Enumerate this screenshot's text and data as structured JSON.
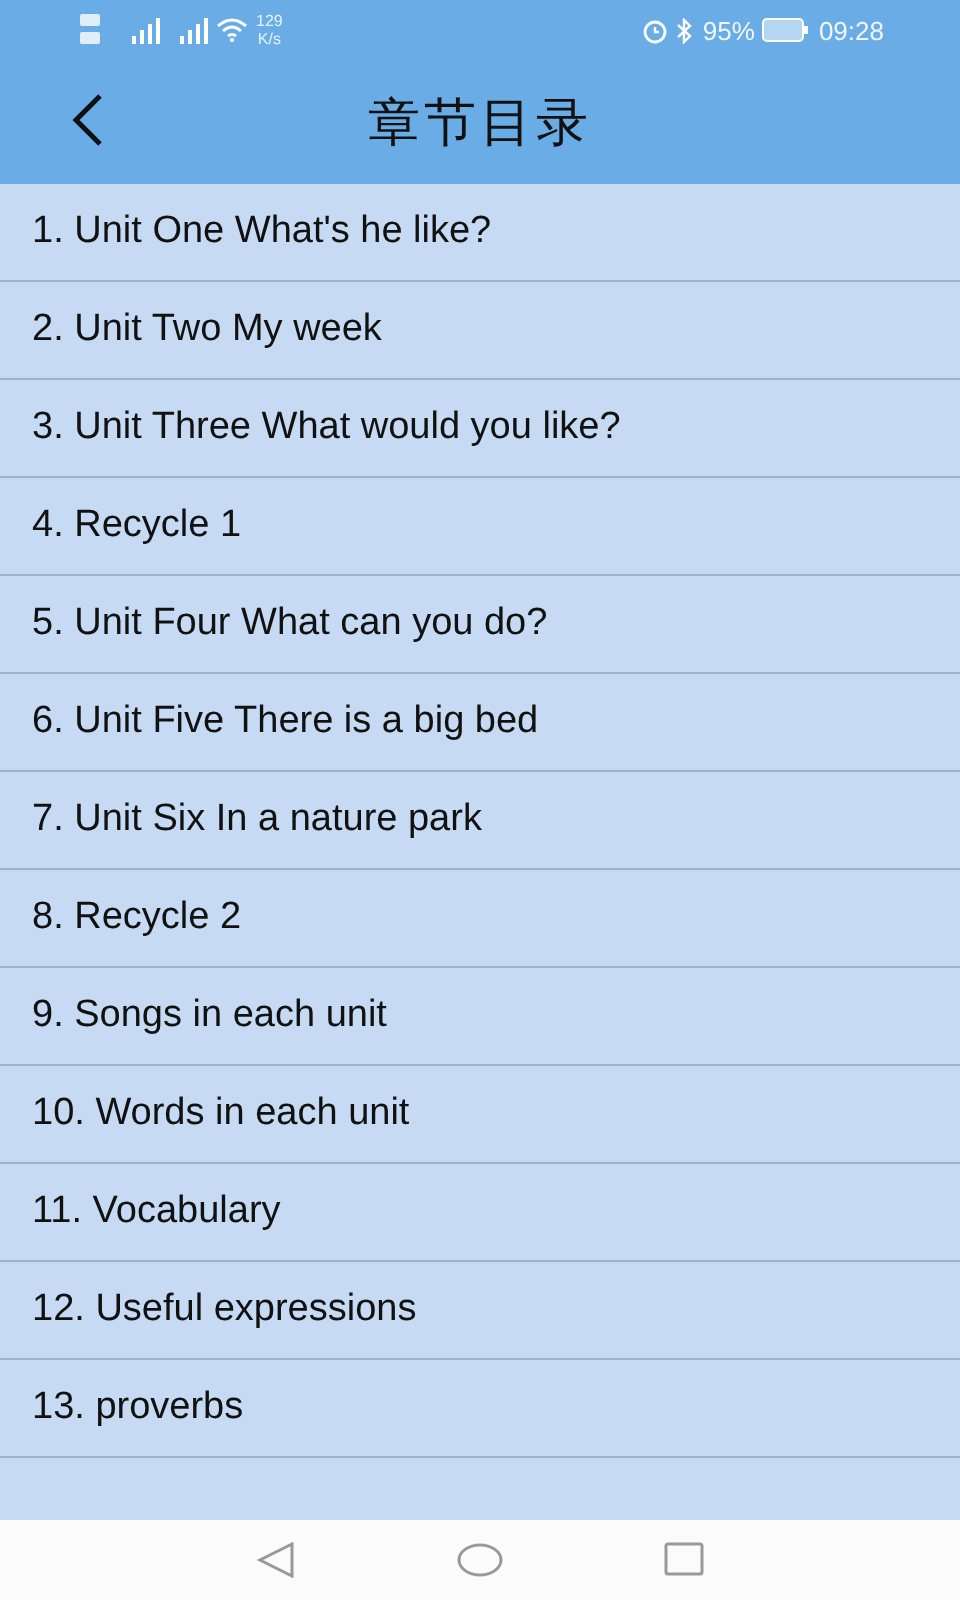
{
  "status_bar": {
    "speed": "129",
    "speed_unit": "K/s",
    "battery": "95%",
    "time": "09:28"
  },
  "header": {
    "title": "章节目录"
  },
  "chapters": [
    {
      "label": "1. Unit One What's he like?"
    },
    {
      "label": "2. Unit Two My week"
    },
    {
      "label": "3. Unit Three What would you like?"
    },
    {
      "label": "4. Recycle 1"
    },
    {
      "label": "5. Unit Four What can you do?"
    },
    {
      "label": "6. Unit Five There is a big bed"
    },
    {
      "label": "7. Unit Six In a nature park"
    },
    {
      "label": "8. Recycle 2"
    },
    {
      "label": "9. Songs in each unit"
    },
    {
      "label": "10. Words in each unit"
    },
    {
      "label": "11. Vocabulary"
    },
    {
      "label": "12. Useful expressions"
    },
    {
      "label": "13. proverbs"
    }
  ]
}
